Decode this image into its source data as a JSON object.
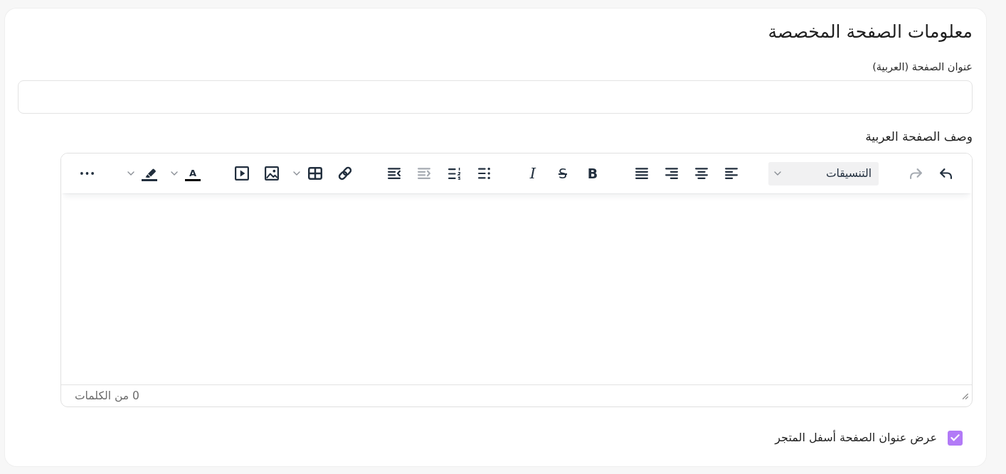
{
  "title": "معلومات الصفحة المخصصة",
  "title_field": {
    "label": "عنوان الصفحة (العربية)"
  },
  "description_editor": {
    "label": "وصف الصفحة العربية",
    "toolbar": [
      {
        "items": [
          {
            "kind": "undo",
            "disabled": false,
            "menu": false
          },
          {
            "kind": "redo",
            "disabled": true,
            "menu": false
          }
        ]
      },
      {
        "items": [
          {
            "kind": "styles",
            "label": "التنسيقات",
            "disabled": false,
            "menu": true
          }
        ]
      },
      {
        "items": [
          {
            "kind": "align_left",
            "disabled": false,
            "menu": false
          },
          {
            "kind": "align_center",
            "disabled": false,
            "menu": false
          },
          {
            "kind": "align_right",
            "disabled": false,
            "menu": false
          },
          {
            "kind": "justify",
            "disabled": false,
            "menu": false
          }
        ]
      },
      {
        "items": [
          {
            "kind": "bold",
            "glyph": "B",
            "disabled": false,
            "menu": false
          },
          {
            "kind": "strikethrough",
            "glyph": "S",
            "disabled": false,
            "menu": false
          },
          {
            "kind": "italic",
            "glyph": "I",
            "disabled": false,
            "menu": false
          }
        ]
      },
      {
        "items": [
          {
            "kind": "bullet_list",
            "disabled": false,
            "menu": false
          },
          {
            "kind": "numbered_list",
            "disabled": false,
            "menu": false
          },
          {
            "kind": "outdent",
            "disabled": true,
            "menu": false
          },
          {
            "kind": "indent",
            "disabled": false,
            "menu": false
          }
        ]
      },
      {
        "items": [
          {
            "kind": "link",
            "disabled": false,
            "menu": false
          },
          {
            "kind": "table",
            "disabled": false,
            "menu": true
          },
          {
            "kind": "image",
            "disabled": false,
            "menu": false
          },
          {
            "kind": "media",
            "disabled": false,
            "menu": false
          }
        ]
      },
      {
        "items": [
          {
            "kind": "text_color",
            "glyph": "A",
            "disabled": false,
            "menu": true
          },
          {
            "kind": "highlight",
            "disabled": false,
            "menu": true
          }
        ]
      },
      {
        "items": [
          {
            "kind": "more",
            "disabled": false,
            "menu": false
          }
        ]
      }
    ],
    "word_count": "0 من الكلمات"
  },
  "show_title_checkbox": {
    "label": "عرض عنوان الصفحة أسفل المتجر",
    "checked": true
  }
}
